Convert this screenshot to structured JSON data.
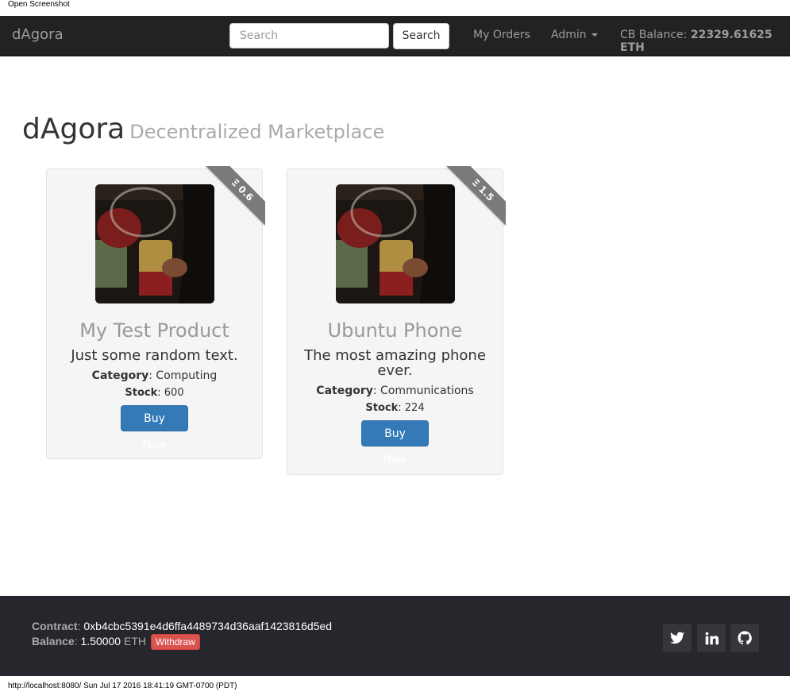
{
  "window": {
    "open_label": "Open Screenshot"
  },
  "navbar": {
    "brand": "dAgora",
    "search_placeholder": "Search",
    "search_button": "Search",
    "my_orders": "My Orders",
    "admin": "Admin",
    "balance_label": "CB Balance:",
    "balance_value": "22329.61625 ETH"
  },
  "page": {
    "title": "dAgora",
    "subtitle": "Decentralized Marketplace"
  },
  "products": [
    {
      "price": "Ξ 0.6",
      "name": "My Test Product",
      "description": "Just some random text.",
      "category_label": "Category",
      "category": ": Computing",
      "stock_label": "Stock",
      "stock": ": 600",
      "buy": "Buy Now"
    },
    {
      "price": "Ξ 1.5",
      "name": "Ubuntu Phone",
      "description": "The most amazing phone ever.",
      "category_label": "Category",
      "category": ": Communications",
      "stock_label": "Stock",
      "stock": ": 224",
      "buy": "Buy Now"
    }
  ],
  "footer": {
    "contract_label": "Contract",
    "contract_value": "0xb4cbc5391e4d6ffa4489734d36aaf1423816d5ed",
    "balance_label": "Balance",
    "balance_value": "1.50000",
    "balance_unit": "ETH",
    "withdraw": "Withdraw",
    "social": [
      "twitter-icon",
      "linkedin-icon",
      "github-icon"
    ]
  },
  "status_bar": "http://localhost:8080/ Sun Jul 17 2016 18:41:19 GMT-0700 (PDT)",
  "colors": {
    "navbar_bg": "#222222",
    "footer_bg": "#25272c",
    "primary": "#337ab7",
    "danger": "#d9534f",
    "ribbon": "#7a7a7a"
  }
}
